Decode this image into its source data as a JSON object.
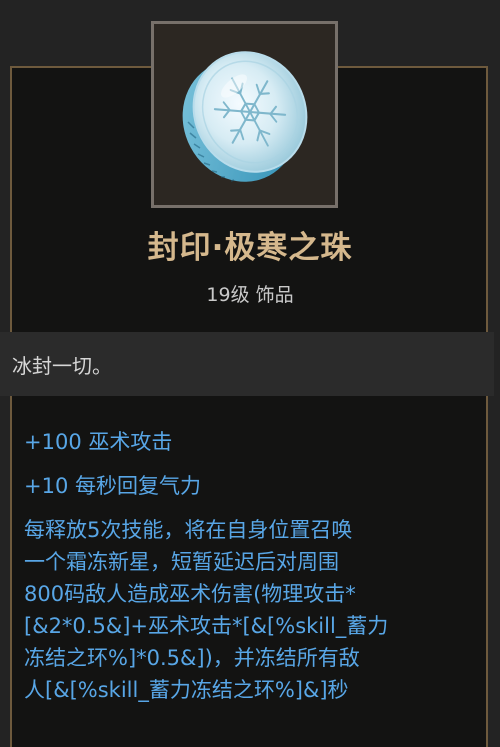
{
  "item": {
    "name": "封印·极寒之珠",
    "level_type": "19级 饰品",
    "icon": "snowflake-coin-icon",
    "flavor": "冰封一切。"
  },
  "stats": [
    "+100 巫术攻击",
    "+10 每秒回复气力"
  ],
  "description": [
    "每释放5次技能，将在自身位置召唤",
    "一个霜冻新星，短暂延迟后对周围",
    "800码敌人造成巫术伤害(物理攻击*",
    "[&2*0.5&]+巫术攻击*[&[%skill_蓄力",
    "冻结之环%]*0.5&])，并冻结所有敌",
    "人[&[%skill_蓄力冻结之环%]&]秒"
  ],
  "colors": {
    "title": "#d5b88d",
    "stat_text": "#58a6e6",
    "border": "#6e5a3d",
    "panel_bg": "#131312",
    "flavor_bg": "#2b2b2b"
  }
}
